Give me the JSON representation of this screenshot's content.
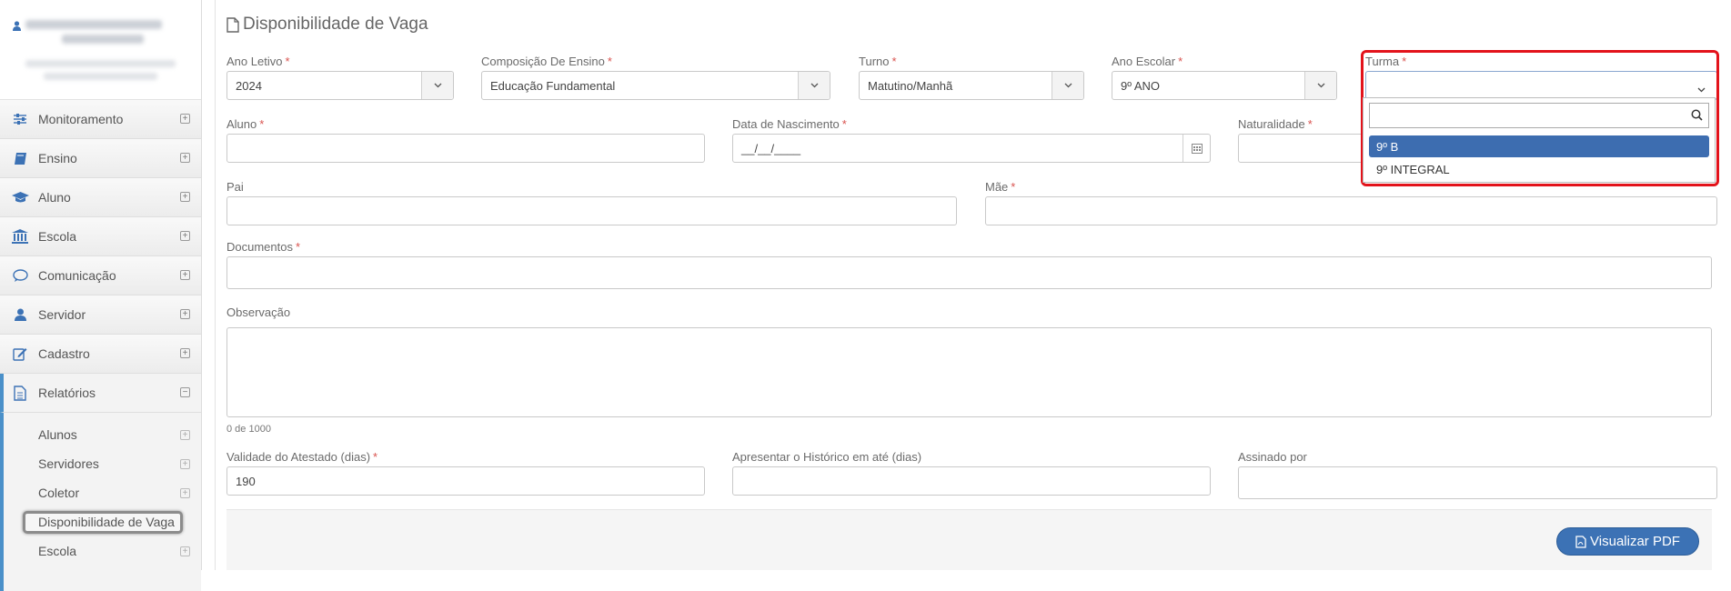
{
  "sidebar": {
    "menu": [
      {
        "label": "Monitoramento",
        "icon": "sliders-icon"
      },
      {
        "label": "Ensino",
        "icon": "book-icon"
      },
      {
        "label": "Aluno",
        "icon": "graduation-cap-icon"
      },
      {
        "label": "Escola",
        "icon": "institution-icon"
      },
      {
        "label": "Comunicação",
        "icon": "chat-bubble-icon"
      },
      {
        "label": "Servidor",
        "icon": "user-icon"
      },
      {
        "label": "Cadastro",
        "icon": "edit-icon"
      },
      {
        "label": "Relatórios",
        "icon": "document-icon"
      }
    ],
    "submenu": [
      {
        "label": "Alunos"
      },
      {
        "label": "Servidores"
      },
      {
        "label": "Coletor"
      },
      {
        "label": "Disponibilidade de Vaga"
      },
      {
        "label": "Escola"
      }
    ]
  },
  "page": {
    "title": "Disponibilidade de Vaga"
  },
  "form": {
    "ano_letivo": {
      "label": "Ano Letivo",
      "value": "2024"
    },
    "composicao": {
      "label": "Composição De Ensino",
      "value": "Educação Fundamental"
    },
    "turno": {
      "label": "Turno",
      "value": "Matutino/Manhã"
    },
    "ano_escolar": {
      "label": "Ano Escolar",
      "value": "9º ANO"
    },
    "turma": {
      "label": "Turma",
      "value": ""
    },
    "aluno": {
      "label": "Aluno",
      "value": ""
    },
    "nascimento": {
      "label": "Data de Nascimento",
      "value": "__/__/____"
    },
    "naturalidade": {
      "label": "Naturalidade",
      "value": ""
    },
    "pai": {
      "label": "Pai",
      "value": ""
    },
    "mae": {
      "label": "Mãe",
      "value": ""
    },
    "documentos": {
      "label": "Documentos",
      "value": ""
    },
    "observacao": {
      "label": "Observação",
      "counter": "0 de 1000"
    },
    "validade": {
      "label": "Validade do Atestado (dias)",
      "value": "190"
    },
    "historico": {
      "label": "Apresentar o Histórico em até (dias)",
      "value": ""
    },
    "assinado": {
      "label": "Assinado por",
      "value": ""
    },
    "required_mark": "*"
  },
  "dropdown": {
    "search_value": "",
    "options": [
      {
        "label": "9º B",
        "selected": true
      },
      {
        "label": "9º INTEGRAL",
        "selected": false
      }
    ]
  },
  "actions": {
    "pdf_label": "Visualizar PDF"
  },
  "colors": {
    "accent": "#3c72b5",
    "required": "#d9534f",
    "highlight": "#e3131b",
    "menu_open_bar": "#4a90c9"
  }
}
